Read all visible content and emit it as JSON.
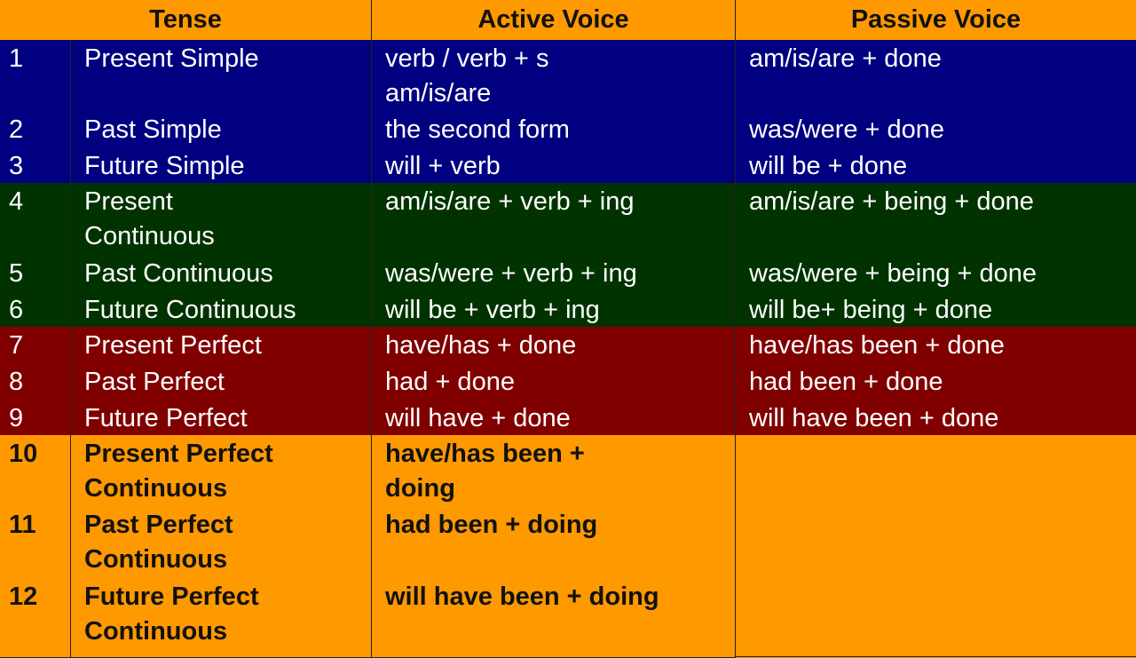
{
  "colors": {
    "header": "#FF9900",
    "simple": "#000080",
    "continuous": "#003300",
    "perfect": "#800000",
    "perfect_continuous": "#FF9900"
  },
  "header": {
    "tense": "Tense",
    "active": "Active Voice",
    "passive": "Passive Voice"
  },
  "rows": [
    {
      "num": "1",
      "tense": "Present Simple",
      "active": "verb / verb + s\nam/is/are",
      "passive": "am/is/are + done"
    },
    {
      "num": "2",
      "tense": "Past Simple",
      "active": "the second form",
      "passive": "was/were + done"
    },
    {
      "num": "3",
      "tense": "Future Simple",
      "active": "will + verb",
      "passive": "will be  + done"
    },
    {
      "num": "4",
      "tense": "Present\nContinuous",
      "active": "am/is/are + verb + ing",
      "passive": "am/is/are + being + done"
    },
    {
      "num": "5",
      "tense": "Past Continuous",
      "active": "was/were + verb + ing",
      "passive": "was/were + being + done"
    },
    {
      "num": "6",
      "tense": "Future Continuous",
      "active": "will be + verb + ing",
      "passive": "will be+ being + done"
    },
    {
      "num": "7",
      "tense": "Present Perfect",
      "active": "have/has + done",
      "passive": "have/has been  + done"
    },
    {
      "num": "8",
      "tense": "Past Perfect",
      "active": "had + done",
      "passive": "had been + done"
    },
    {
      "num": "9",
      "tense": "Future Perfect",
      "active": "will have + done",
      "passive": "will have been + done"
    },
    {
      "num": "10",
      "tense": "Present Perfect\nContinuous",
      "active": "have/has been  +\ndoing",
      "passive": ""
    },
    {
      "num": "11",
      "tense": "Past Perfect\nContinuous",
      "active": "had been + doing",
      "passive": ""
    },
    {
      "num": "12",
      "tense": "Future Perfect\nContinuous",
      "active": "will have been + doing",
      "passive": ""
    }
  ]
}
